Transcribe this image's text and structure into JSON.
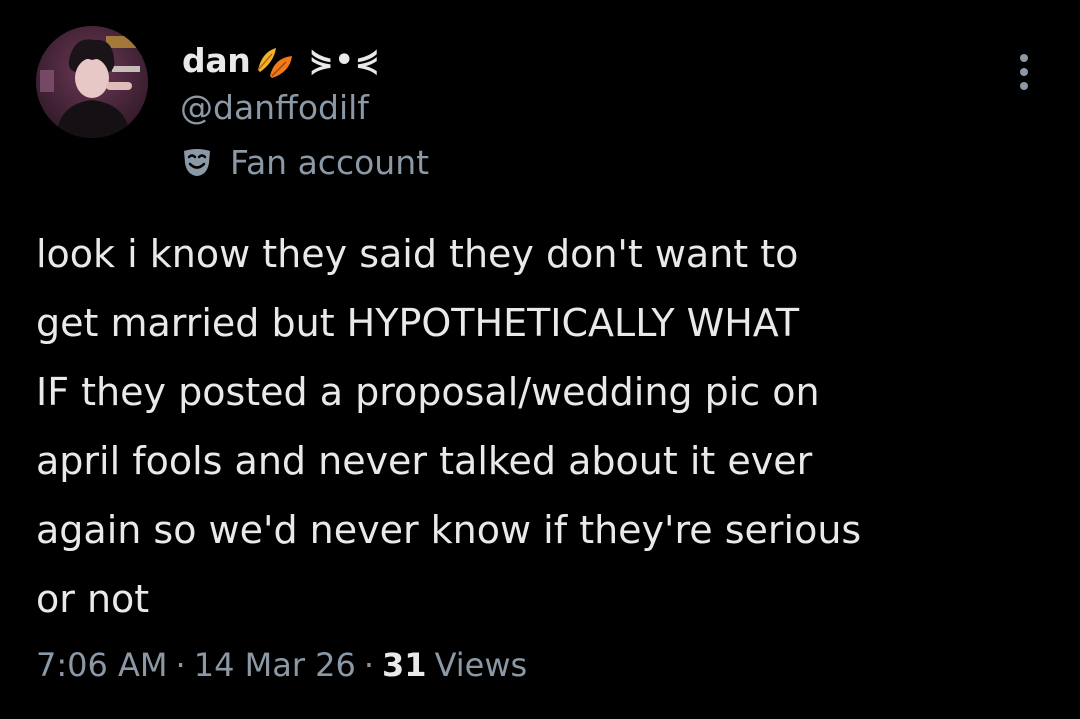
{
  "author": {
    "display_name": "dan",
    "name_emoji": "leaf-icon",
    "name_suffix": "⋟•⋞",
    "handle": "@danffodilf",
    "label_icon": "mask-icon",
    "label": "Fan account",
    "avatar": "avatar"
  },
  "tweet": {
    "text_lines": [
      "look i know they said they don't want to",
      "get married but HYPOTHETICALLY WHAT",
      "IF they posted a proposal/wedding pic on",
      "april fools and never talked about it ever",
      "again so we'd never know if they're serious",
      "or not"
    ]
  },
  "meta": {
    "time": "7:06 AM",
    "separator": "·",
    "date": "14 Mar 26",
    "views_count": "31",
    "views_label": "Views"
  },
  "menu": {
    "icon": "more-options-icon"
  },
  "colors": {
    "background": "#000000",
    "primary_text": "#e7e9ea",
    "secondary_text": "#8b98a5",
    "leaf_orange": "#f28c1c"
  }
}
